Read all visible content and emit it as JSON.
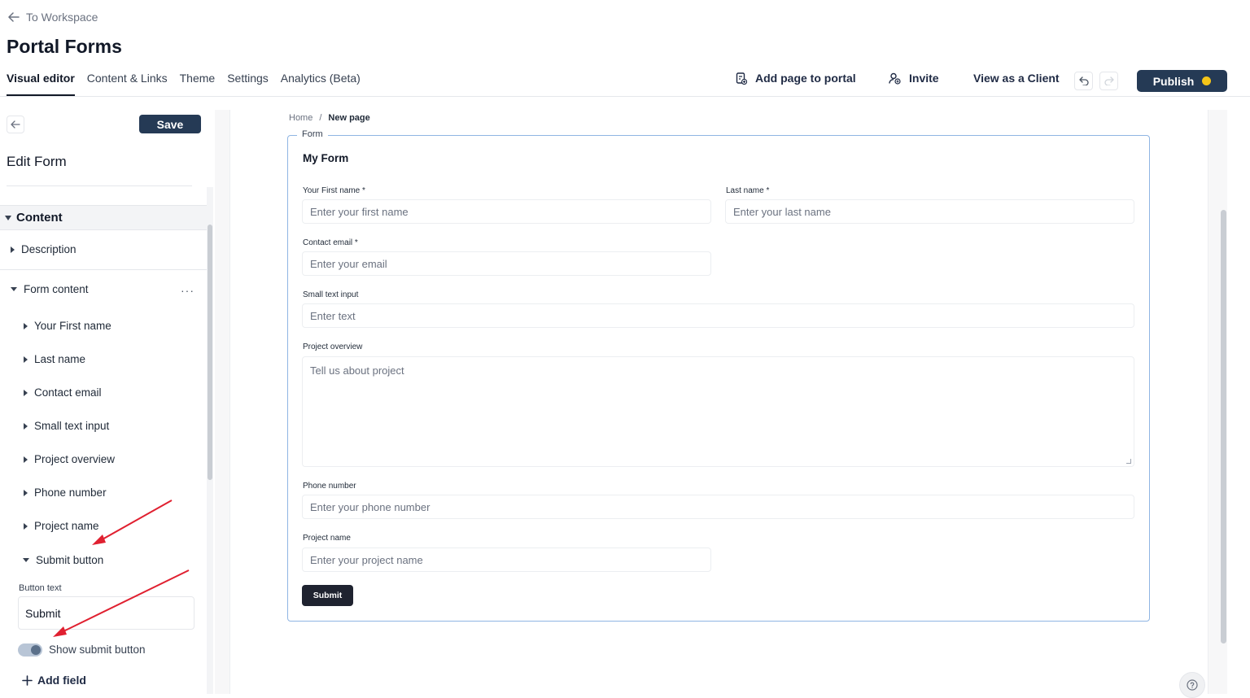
{
  "header": {
    "back_label": "To Workspace",
    "title": "Portal Forms",
    "tabs": [
      {
        "label": "Visual editor",
        "active": true
      },
      {
        "label": "Content & Links"
      },
      {
        "label": "Theme"
      },
      {
        "label": "Settings"
      },
      {
        "label": "Analytics (Beta)"
      }
    ],
    "actions": {
      "add_page": "Add page to portal",
      "invite": "Invite",
      "view_as_client": "View as a Client",
      "publish": "Publish"
    },
    "colors": {
      "primary": "#253a55",
      "publish_indicator": "#f5c518"
    }
  },
  "sidebar": {
    "save_label": "Save",
    "title": "Edit Form",
    "section": "Content",
    "description": "Description",
    "form_content": "Form content",
    "fields": [
      "Your First name",
      "Last name",
      "Contact email",
      "Small text input",
      "Project overview",
      "Phone number",
      "Project name"
    ],
    "submit_button": "Submit button",
    "button_text_label": "Button text",
    "button_text_value": "Submit",
    "show_submit_label": "Show submit button",
    "show_submit_on": true,
    "add_field": "Add field"
  },
  "breadcrumb": {
    "home": "Home",
    "separator": "/",
    "current": "New page"
  },
  "form": {
    "tag": "Form",
    "title": "My Form",
    "first_name": {
      "label": "Your First name *",
      "placeholder": "Enter your first name"
    },
    "last_name": {
      "label": "Last name *",
      "placeholder": "Enter your last name"
    },
    "email": {
      "label": "Contact email *",
      "placeholder": "Enter your email"
    },
    "small_text": {
      "label": "Small text input",
      "placeholder": "Enter text"
    },
    "overview": {
      "label": "Project overview",
      "placeholder": "Tell us about project"
    },
    "phone": {
      "label": "Phone number",
      "placeholder": "Enter your phone number"
    },
    "project_name": {
      "label": "Project name",
      "placeholder": "Enter your project name"
    },
    "submit": "Submit"
  },
  "icons": {
    "back": "arrow-left-icon",
    "add_page": "page-add-icon",
    "invite": "user-add-icon",
    "undo": "undo-icon",
    "redo": "redo-icon",
    "help": "question-icon",
    "plus": "plus-icon"
  },
  "annotations": {
    "arrow_color": "#e02030"
  }
}
